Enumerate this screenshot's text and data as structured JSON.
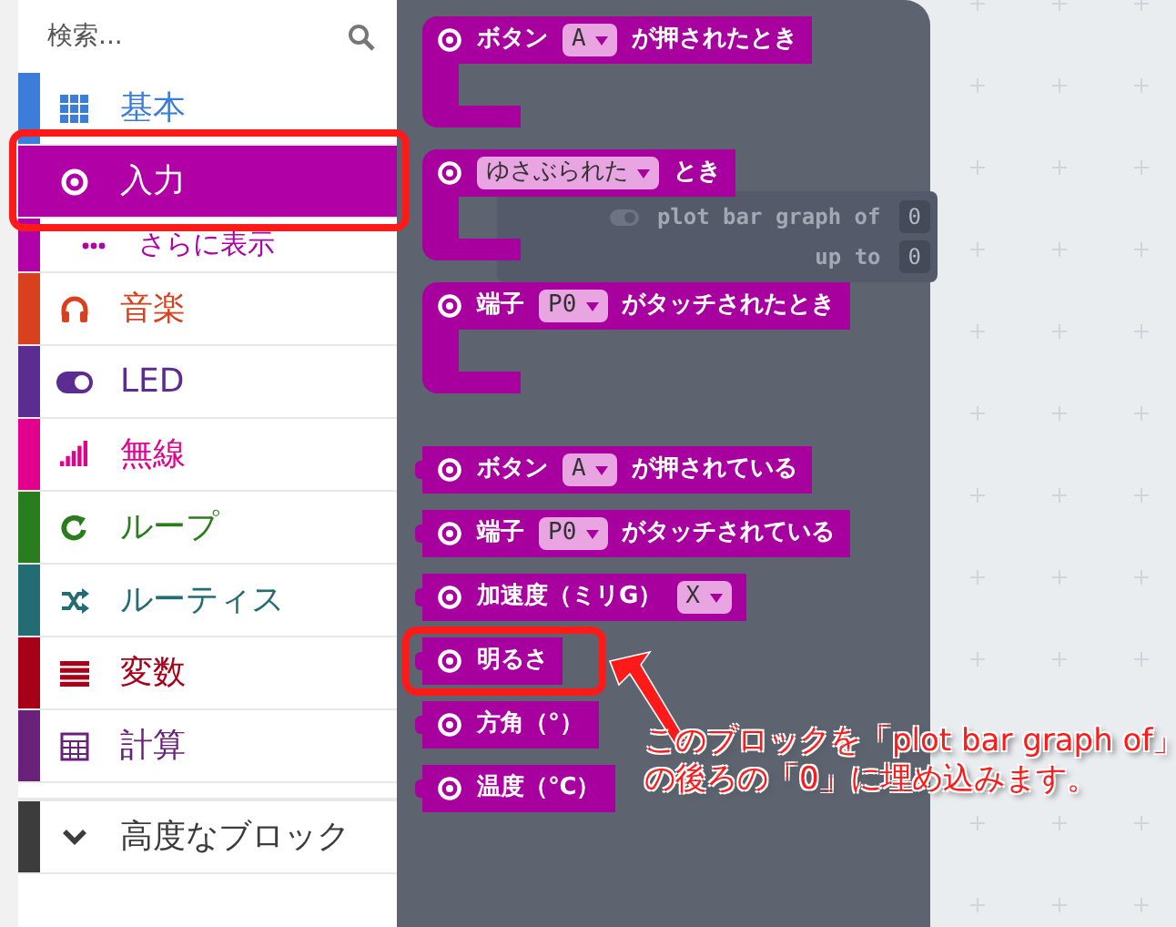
{
  "search": {
    "placeholder": "検索..."
  },
  "categories": [
    {
      "label": "基本",
      "color": "#3c7dd9",
      "selected": false
    },
    {
      "label": "入力",
      "color": "#b000a6",
      "selected": true,
      "more": {
        "label": "さらに表示"
      }
    },
    {
      "label": "音楽",
      "color": "#d8401e",
      "selected": false
    },
    {
      "label": "LED",
      "color": "#5c2d91",
      "selected": false
    },
    {
      "label": "無線",
      "color": "#e3008c",
      "selected": false
    },
    {
      "label": "ループ",
      "color": "#2a7d1e",
      "selected": false
    },
    {
      "label": "ルーティス",
      "color": "#246c73",
      "selected": false
    },
    {
      "label": "変数",
      "color": "#a80018",
      "selected": false
    },
    {
      "label": "計算",
      "color": "#69217a",
      "selected": false
    }
  ],
  "advanced": {
    "label": "高度なブロック"
  },
  "blocks": [
    {
      "kind": "hat",
      "parts": [
        {
          "kind": "text",
          "text": "ボタン"
        },
        {
          "kind": "dropdown",
          "text": "A"
        },
        {
          "kind": "text",
          "text": "が押されたとき"
        }
      ]
    },
    {
      "kind": "hat",
      "parts": [
        {
          "kind": "dropdown",
          "text": "ゆさぶられた"
        },
        {
          "kind": "text",
          "text": "とき"
        }
      ]
    },
    {
      "kind": "hat",
      "parts": [
        {
          "kind": "text",
          "text": "端子"
        },
        {
          "kind": "dropdown",
          "text": "P0"
        },
        {
          "kind": "text",
          "text": "がタッチされたとき"
        }
      ]
    },
    {
      "kind": "reporter",
      "parts": [
        {
          "kind": "text",
          "text": "ボタン"
        },
        {
          "kind": "dropdown",
          "text": "A"
        },
        {
          "kind": "text",
          "text": "が押されている"
        }
      ]
    },
    {
      "kind": "reporter",
      "parts": [
        {
          "kind": "text",
          "text": "端子"
        },
        {
          "kind": "dropdown",
          "text": "P0"
        },
        {
          "kind": "text",
          "text": "がタッチされている"
        }
      ]
    },
    {
      "kind": "reporter",
      "parts": [
        {
          "kind": "text",
          "text": "加速度（ミリG）"
        },
        {
          "kind": "dropdown",
          "text": "X"
        }
      ]
    },
    {
      "kind": "reporter",
      "highlighted": true,
      "parts": [
        {
          "kind": "text",
          "text": "明るさ"
        }
      ]
    },
    {
      "kind": "reporter",
      "parts": [
        {
          "kind": "text",
          "text": "方角（°）"
        }
      ]
    },
    {
      "kind": "reporter",
      "parts": [
        {
          "kind": "text",
          "text": "温度（℃）"
        }
      ]
    }
  ],
  "ghost_block": {
    "rows": [
      {
        "label": "plot bar graph of",
        "value": "0"
      },
      {
        "label": "up to",
        "value": "0"
      }
    ]
  },
  "callout": {
    "lines": [
      "このブロックを「plot bar graph of」",
      "の後ろの「0」に埋め込みます。"
    ]
  }
}
